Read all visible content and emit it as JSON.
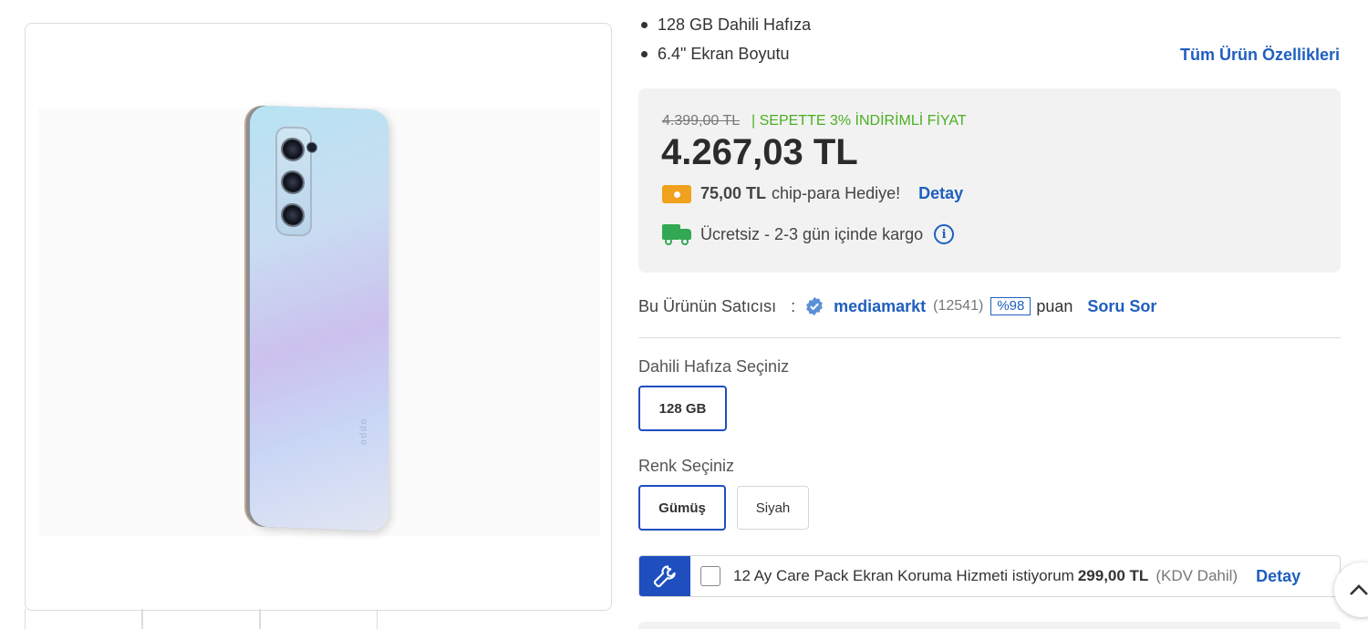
{
  "specs": [
    {
      "label": "128 GB Dahili Hafıza"
    },
    {
      "label": "6.4\" Ekran Boyutu"
    }
  ],
  "all_features_link": "Tüm Ürün Özellikleri",
  "price_box": {
    "old_price": "4.399,00 TL",
    "promo_text": "| SEPETTE 3% İNDİRİMLİ FİYAT",
    "current_price": "4.267,03 TL",
    "chip_amount": "75,00 TL",
    "chip_text": "chip-para Hediye!",
    "chip_detail_link": "Detay",
    "shipping_text": "Ücretsiz - 2-3 gün içinde kargo",
    "info_glyph": "i"
  },
  "seller": {
    "label": "Bu Ürünün Satıcısı",
    "colon": ":",
    "name": "mediamarkt",
    "rating_count": "(12541)",
    "score": "%98",
    "score_suffix": "puan",
    "ask_link": "Soru Sor"
  },
  "memory": {
    "title": "Dahili Hafıza Seçiniz",
    "options": [
      {
        "label": "128 GB",
        "selected": true
      }
    ]
  },
  "color": {
    "title": "Renk Seçiniz",
    "options": [
      {
        "label": "Gümüş",
        "selected": true
      },
      {
        "label": "Siyah",
        "selected": false
      }
    ]
  },
  "care_pack": {
    "text": "12 Ay Care Pack Ekran Koruma Hizmeti istiyorum",
    "price": "299,00 TL",
    "tax_note": "(KDV Dahil)",
    "detail_link": "Detay",
    "checked": false
  },
  "product_image": {
    "brand_mark": "oppo"
  },
  "colors": {
    "link": "#1f5fbf",
    "promo_green": "#4caf22",
    "chip_orange": "#f0a11d",
    "truck_green": "#32a852",
    "care_blue": "#1f4fbf"
  },
  "icons": [
    "chip-para-icon",
    "truck-icon",
    "info-icon",
    "verified-badge-icon",
    "wrench-icon",
    "chevron-up-icon"
  ]
}
